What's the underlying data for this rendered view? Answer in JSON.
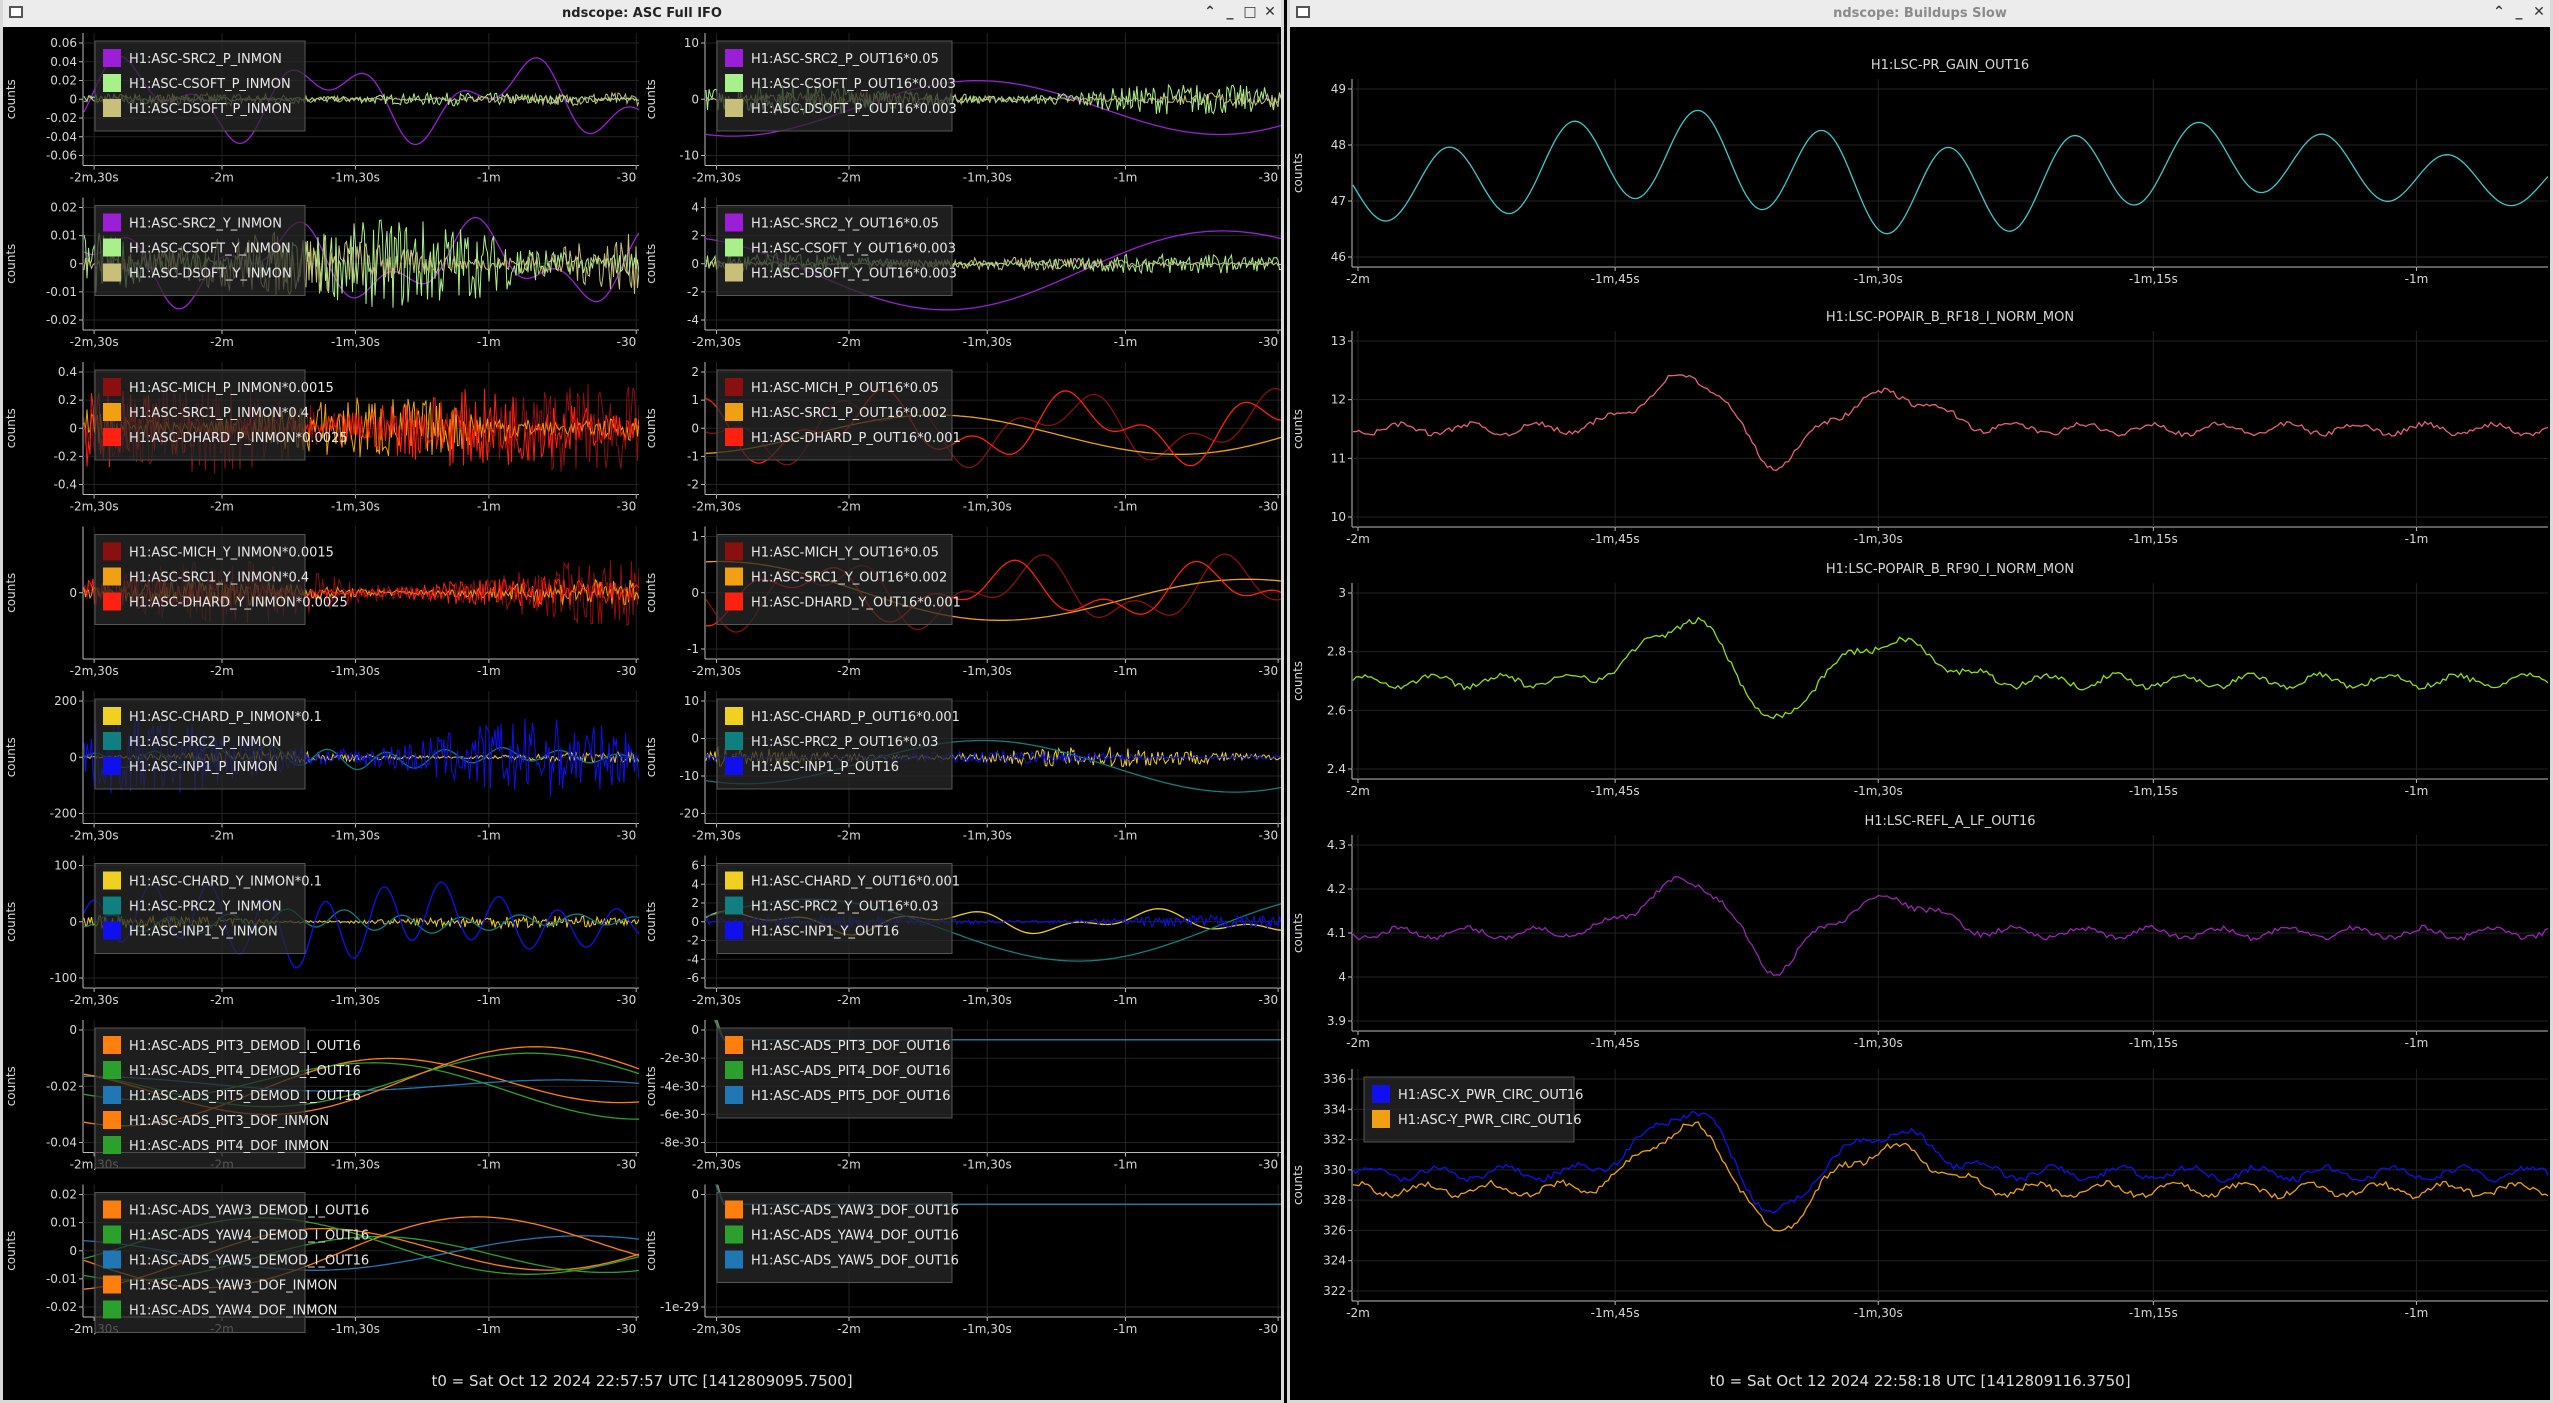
{
  "windows": [
    {
      "title": "ndscope: ASC Full IFO",
      "footer": "t0 = Sat Oct 12 2024 22:57:57 UTC [1412809095.7500]",
      "plots": [
        {
          "ylabel": "counts",
          "yticks": [
            "0.06",
            "0.04",
            "0.02",
            "0",
            "-0.02",
            "-0.04",
            "-0.06"
          ],
          "xticks": [
            "-2m,30s",
            "-2m",
            "-1m,30s",
            "-1m",
            "-30"
          ],
          "legend": [
            {
              "label": "H1:ASC-SRC2_P_INMON",
              "color": "#9b1fd6"
            },
            {
              "label": "H1:ASC-CSOFT_P_INMON",
              "color": "#a8f08a"
            },
            {
              "label": "H1:ASC-DSOFT_P_INMON",
              "color": "#c8c07a"
            }
          ]
        },
        {
          "ylabel": "counts",
          "yticks": [
            "10",
            "0",
            "-10"
          ],
          "xticks": [
            "-2m,30s",
            "-2m",
            "-1m,30s",
            "-1m",
            "-30"
          ],
          "legend": [
            {
              "label": "H1:ASC-SRC2_P_OUT16*0.05",
              "color": "#9b1fd6"
            },
            {
              "label": "H1:ASC-CSOFT_P_OUT16*0.003",
              "color": "#a8f08a"
            },
            {
              "label": "H1:ASC-DSOFT_P_OUT16*0.003",
              "color": "#c8c07a"
            }
          ]
        },
        {
          "ylabel": "counts",
          "yticks": [
            "0.02",
            "0.01",
            "0",
            "-0.01",
            "-0.02"
          ],
          "xticks": [
            "-2m,30s",
            "-2m",
            "-1m,30s",
            "-1m",
            "-30"
          ],
          "legend": [
            {
              "label": "H1:ASC-SRC2_Y_INMON",
              "color": "#9b1fd6"
            },
            {
              "label": "H1:ASC-CSOFT_Y_INMON",
              "color": "#a8f08a"
            },
            {
              "label": "H1:ASC-DSOFT_Y_INMON",
              "color": "#c8c07a"
            }
          ]
        },
        {
          "ylabel": "counts",
          "yticks": [
            "4",
            "2",
            "0",
            "-2",
            "-4"
          ],
          "xticks": [
            "-2m,30s",
            "-2m",
            "-1m,30s",
            "-1m",
            "-30"
          ],
          "legend": [
            {
              "label": "H1:ASC-SRC2_Y_OUT16*0.05",
              "color": "#9b1fd6"
            },
            {
              "label": "H1:ASC-CSOFT_Y_OUT16*0.003",
              "color": "#a8f08a"
            },
            {
              "label": "H1:ASC-DSOFT_Y_OUT16*0.003",
              "color": "#c8c07a"
            }
          ]
        },
        {
          "ylabel": "counts",
          "yticks": [
            "0.4",
            "0.2",
            "0",
            "-0.2",
            "-0.4"
          ],
          "xticks": [
            "-2m,30s",
            "-2m",
            "-1m,30s",
            "-1m",
            "-30"
          ],
          "legend": [
            {
              "label": "H1:ASC-MICH_P_INMON*0.0015",
              "color": "#8a0f0f"
            },
            {
              "label": "H1:ASC-SRC1_P_INMON*0.4",
              "color": "#f0a010"
            },
            {
              "label": "H1:ASC-DHARD_P_INMON*0.0025",
              "color": "#ff2010"
            }
          ]
        },
        {
          "ylabel": "counts",
          "yticks": [
            "2",
            "1",
            "0",
            "-1",
            "-2"
          ],
          "xticks": [
            "-2m,30s",
            "-2m",
            "-1m,30s",
            "-1m",
            "-30"
          ],
          "legend": [
            {
              "label": "H1:ASC-MICH_P_OUT16*0.05",
              "color": "#8a0f0f"
            },
            {
              "label": "H1:ASC-SRC1_P_OUT16*0.002",
              "color": "#f0a010"
            },
            {
              "label": "H1:ASC-DHARD_P_OUT16*0.001",
              "color": "#ff2010"
            }
          ]
        },
        {
          "ylabel": "counts",
          "yticks": [
            "0"
          ],
          "xticks": [
            "-2m,30s",
            "-2m",
            "-1m,30s",
            "-1m",
            "-30"
          ],
          "legend": [
            {
              "label": "H1:ASC-MICH_Y_INMON*0.0015",
              "color": "#8a0f0f"
            },
            {
              "label": "H1:ASC-SRC1_Y_INMON*0.4",
              "color": "#f0a010"
            },
            {
              "label": "H1:ASC-DHARD_Y_INMON*0.0025",
              "color": "#ff2010"
            }
          ]
        },
        {
          "ylabel": "counts",
          "yticks": [
            "1",
            "0",
            "-1"
          ],
          "xticks": [
            "-2m,30s",
            "-2m",
            "-1m,30s",
            "-1m",
            "-30"
          ],
          "legend": [
            {
              "label": "H1:ASC-MICH_Y_OUT16*0.05",
              "color": "#8a0f0f"
            },
            {
              "label": "H1:ASC-SRC1_Y_OUT16*0.002",
              "color": "#f0a010"
            },
            {
              "label": "H1:ASC-DHARD_Y_OUT16*0.001",
              "color": "#ff2010"
            }
          ]
        },
        {
          "ylabel": "counts",
          "yticks": [
            "200",
            "0",
            "-200"
          ],
          "xticks": [
            "-2m,30s",
            "-2m",
            "-1m,30s",
            "-1m",
            "-30"
          ],
          "legend": [
            {
              "label": "H1:ASC-CHARD_P_INMON*0.1",
              "color": "#f0d020"
            },
            {
              "label": "H1:ASC-PRC2_P_INMON",
              "color": "#0f7f7f"
            },
            {
              "label": "H1:ASC-INP1_P_INMON",
              "color": "#1010ee"
            }
          ]
        },
        {
          "ylabel": "counts",
          "yticks": [
            "10",
            "0",
            "-10",
            "-20"
          ],
          "xticks": [
            "-2m,30s",
            "-2m",
            "-1m,30s",
            "-1m",
            "-30"
          ],
          "legend": [
            {
              "label": "H1:ASC-CHARD_P_OUT16*0.001",
              "color": "#f0d020"
            },
            {
              "label": "H1:ASC-PRC2_P_OUT16*0.03",
              "color": "#0f7f7f"
            },
            {
              "label": "H1:ASC-INP1_P_OUT16",
              "color": "#1010ee"
            }
          ]
        },
        {
          "ylabel": "counts",
          "yticks": [
            "100",
            "0",
            "-100"
          ],
          "xticks": [
            "-2m,30s",
            "-2m",
            "-1m,30s",
            "-1m",
            "-30"
          ],
          "legend": [
            {
              "label": "H1:ASC-CHARD_Y_INMON*0.1",
              "color": "#f0d020"
            },
            {
              "label": "H1:ASC-PRC2_Y_INMON",
              "color": "#0f7f7f"
            },
            {
              "label": "H1:ASC-INP1_Y_INMON",
              "color": "#1010ee"
            }
          ]
        },
        {
          "ylabel": "counts",
          "yticks": [
            "6",
            "4",
            "2",
            "0",
            "-2",
            "-4",
            "-6"
          ],
          "xticks": [
            "-2m,30s",
            "-2m",
            "-1m,30s",
            "-1m",
            "-30"
          ],
          "legend": [
            {
              "label": "H1:ASC-CHARD_Y_OUT16*0.001",
              "color": "#f0d020"
            },
            {
              "label": "H1:ASC-PRC2_Y_OUT16*0.03",
              "color": "#0f7f7f"
            },
            {
              "label": "H1:ASC-INP1_Y_OUT16",
              "color": "#1010ee"
            }
          ]
        },
        {
          "ylabel": "counts",
          "yticks": [
            "0",
            "-0.02",
            "-0.04"
          ],
          "xticks": [
            "-2m,30s",
            "-2m",
            "-1m,30s",
            "-1m",
            "-30"
          ],
          "legend": [
            {
              "label": "H1:ASC-ADS_PIT3_DEMOD_I_OUT16",
              "color": "#ff7f0e"
            },
            {
              "label": "H1:ASC-ADS_PIT4_DEMOD_I_OUT16",
              "color": "#2ca02c"
            },
            {
              "label": "H1:ASC-ADS_PIT5_DEMOD_I_OUT16",
              "color": "#1f77b4"
            },
            {
              "label": "H1:ASC-ADS_PIT3_DOF_INMON",
              "color": "#ff7f0e"
            },
            {
              "label": "H1:ASC-ADS_PIT4_DOF_INMON",
              "color": "#2ca02c"
            }
          ]
        },
        {
          "ylabel": "counts",
          "yticks": [
            "0",
            "-2e-30",
            "-4e-30",
            "-6e-30",
            "-8e-30"
          ],
          "xticks": [
            "-2m,30s",
            "-2m",
            "-1m,30s",
            "-1m",
            "-30"
          ],
          "legend": [
            {
              "label": "H1:ASC-ADS_PIT3_DOF_OUT16",
              "color": "#ff7f0e"
            },
            {
              "label": "H1:ASC-ADS_PIT4_DOF_OUT16",
              "color": "#2ca02c"
            },
            {
              "label": "H1:ASC-ADS_PIT5_DOF_OUT16",
              "color": "#1f77b4"
            }
          ]
        },
        {
          "ylabel": "counts",
          "yticks": [
            "0.02",
            "0.01",
            "0",
            "-0.01",
            "-0.02"
          ],
          "xticks": [
            "-2m,30s",
            "-2m",
            "-1m,30s",
            "-1m",
            "-30"
          ],
          "legend": [
            {
              "label": "H1:ASC-ADS_YAW3_DEMOD_I_OUT16",
              "color": "#ff7f0e"
            },
            {
              "label": "H1:ASC-ADS_YAW4_DEMOD_I_OUT16",
              "color": "#2ca02c"
            },
            {
              "label": "H1:ASC-ADS_YAW5_DEMOD_I_OUT16",
              "color": "#1f77b4"
            },
            {
              "label": "H1:ASC-ADS_YAW3_DOF_INMON",
              "color": "#ff7f0e"
            },
            {
              "label": "H1:ASC-ADS_YAW4_DOF_INMON",
              "color": "#2ca02c"
            }
          ]
        },
        {
          "ylabel": "counts",
          "yticks": [
            "0",
            "-1e-29"
          ],
          "xticks": [
            "-2m,30s",
            "-2m",
            "-1m,30s",
            "-1m",
            "-30"
          ],
          "legend": [
            {
              "label": "H1:ASC-ADS_YAW3_DOF_OUT16",
              "color": "#ff7f0e"
            },
            {
              "label": "H1:ASC-ADS_YAW4_DOF_OUT16",
              "color": "#2ca02c"
            },
            {
              "label": "H1:ASC-ADS_YAW5_DOF_OUT16",
              "color": "#1f77b4"
            }
          ]
        }
      ]
    },
    {
      "title": "ndscope: Buildups Slow",
      "footer": "t0 = Sat Oct 12 2024 22:58:18 UTC [1412809116.3750]",
      "plots": [
        {
          "title": "H1:LSC-PR_GAIN_OUT16",
          "ylabel": "counts",
          "yticks": [
            "49",
            "48",
            "47",
            "46"
          ],
          "xticks": [
            "-2m",
            "-1m,45s",
            "-1m,30s",
            "-1m,15s",
            "-1m"
          ],
          "legend": [],
          "color": "#3fc9c9"
        },
        {
          "title": "H1:LSC-POPAIR_B_RF18_I_NORM_MON",
          "ylabel": "counts",
          "yticks": [
            "13",
            "12",
            "11",
            "10"
          ],
          "xticks": [
            "-2m",
            "-1m,45s",
            "-1m,30s",
            "-1m,15s",
            "-1m"
          ],
          "legend": [],
          "color": "#e8607a"
        },
        {
          "title": "H1:LSC-POPAIR_B_RF90_I_NORM_MON",
          "ylabel": "counts",
          "yticks": [
            "3",
            "2.8",
            "2.6",
            "2.4"
          ],
          "xticks": [
            "-2m",
            "-1m,45s",
            "-1m,30s",
            "-1m,15s",
            "-1m"
          ],
          "legend": [],
          "color": "#8ee01a"
        },
        {
          "title": "H1:LSC-REFL_A_LF_OUT16",
          "ylabel": "counts",
          "yticks": [
            "4.3",
            "4.2",
            "4.1",
            "4",
            "3.9"
          ],
          "xticks": [
            "-2m",
            "-1m,45s",
            "-1m,30s",
            "-1m,15s",
            "-1m"
          ],
          "legend": [],
          "color": "#9a22b8"
        },
        {
          "title": "",
          "ylabel": "counts",
          "yticks": [
            "336",
            "334",
            "332",
            "330",
            "328",
            "326",
            "324",
            "322"
          ],
          "xticks": [
            "-2m",
            "-1m,45s",
            "-1m,30s",
            "-1m,15s",
            "-1m"
          ],
          "legend": [
            {
              "label": "H1:ASC-X_PWR_CIRC_OUT16",
              "color": "#1010ee"
            },
            {
              "label": "H1:ASC-Y_PWR_CIRC_OUT16",
              "color": "#f0a010"
            }
          ]
        }
      ]
    }
  ]
}
